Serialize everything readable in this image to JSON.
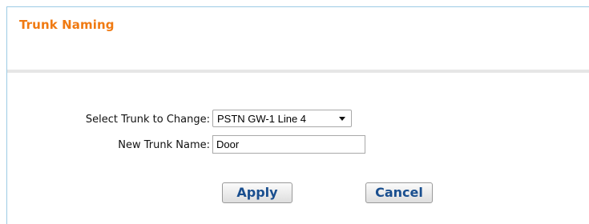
{
  "panel": {
    "title": "Trunk Naming"
  },
  "form": {
    "select_label": "Select Trunk to Change:",
    "select_value": "PSTN GW-1 Line 4",
    "name_label": "New Trunk Name:",
    "name_value": "Door"
  },
  "buttons": {
    "apply": "Apply",
    "cancel": "Cancel"
  },
  "colors": {
    "title": "#f07a12",
    "button_text": "#1a4f8f",
    "panel_border": "#9ccbe4"
  }
}
